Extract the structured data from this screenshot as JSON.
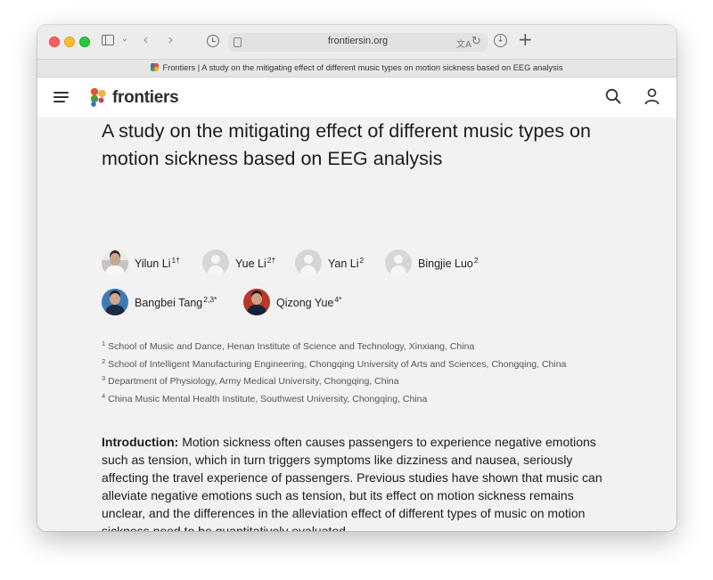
{
  "browser": {
    "url": "frontiersin.org",
    "tab_title": "Frontiers | A study on the mitigating effect of different music types on motion sickness based on EEG analysis"
  },
  "site": {
    "logo_text": "frontiers",
    "brand_colors": [
      "#e8542e",
      "#f4b13d",
      "#4a9d3c",
      "#3a6fb5"
    ],
    "icons": [
      "menu-icon",
      "search-icon",
      "profile-icon"
    ]
  },
  "article": {
    "title": "A study on the mitigating effect of different music types on motion sickness based on EEG analysis",
    "authors": [
      {
        "name": "Yilun Li",
        "sup": "1†",
        "avatar": "photo"
      },
      {
        "name": "Yue Li",
        "sup": "2†",
        "avatar": "placeholder"
      },
      {
        "name": "Yan Li",
        "sup": "2",
        "avatar": "placeholder"
      },
      {
        "name": "Bingjie Luo",
        "sup": "2",
        "avatar": "placeholder"
      },
      {
        "name": "Bangbei Tang",
        "sup": "2,3*",
        "avatar": "photo"
      },
      {
        "name": "Qizong Yue",
        "sup": "4*",
        "avatar": "photo"
      }
    ],
    "affiliations": [
      {
        "num": "1",
        "text": "School of Music and Dance, Henan Institute of Science and Technology, Xinxiang, China"
      },
      {
        "num": "2",
        "text": "School of Intelligent Manufacturing Engineering, Chongqing University of Arts and Sciences, Chongqing, China"
      },
      {
        "num": "3",
        "text": "Department of Physiology, Army Medical University, Chongqing, China"
      },
      {
        "num": "4",
        "text": "China Music Mental Health Institute, Southwest University, Chongqing, China"
      }
    ],
    "abstract": {
      "label": "Introduction:",
      "text": " Motion sickness often causes passengers to experience negative emotions such as tension, which in turn triggers symptoms like dizziness and nausea, seriously affecting the travel experience of passengers. Previous studies have shown that music can alleviate negative emotions such as tension, but its effect on motion sickness remains unclear, and the differences in the alleviation effect of different types of music on motion sickness need to be quantitatively evaluated."
    }
  }
}
